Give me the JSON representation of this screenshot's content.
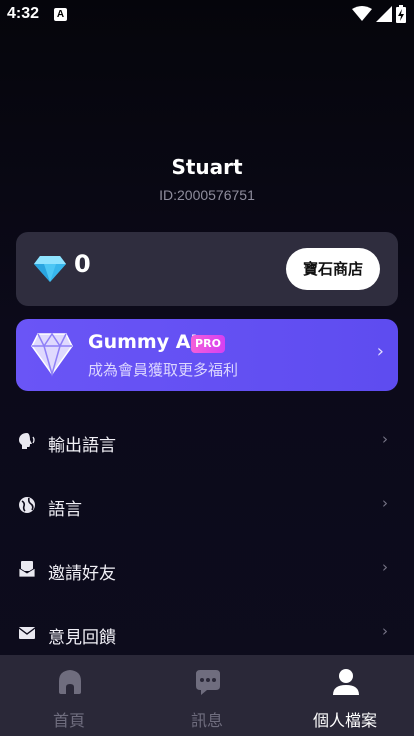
{
  "status_bar": {
    "time": "4:32",
    "notification_letter": "A"
  },
  "profile": {
    "name": "Stuart",
    "id_text": "ID:2000576751"
  },
  "gem_card": {
    "count": "0",
    "store_button": "寶石商店"
  },
  "pro_card": {
    "title": "Gummy AI",
    "badge": "PRO",
    "subtitle": "成為會員獲取更多福利",
    "accent": "#6a55f6"
  },
  "menu": [
    {
      "label": "輸出語言",
      "icon": "speaking-head-icon"
    },
    {
      "label": "語言",
      "icon": "globe-icon"
    },
    {
      "label": "邀請好友",
      "icon": "invite-icon"
    },
    {
      "label": "意見回饋",
      "icon": "mail-icon"
    }
  ],
  "tabs": [
    {
      "label": "首頁",
      "icon": "home-icon"
    },
    {
      "label": "訊息",
      "icon": "chat-icon"
    },
    {
      "label": "個人檔案",
      "icon": "profile-icon",
      "active": true
    }
  ]
}
